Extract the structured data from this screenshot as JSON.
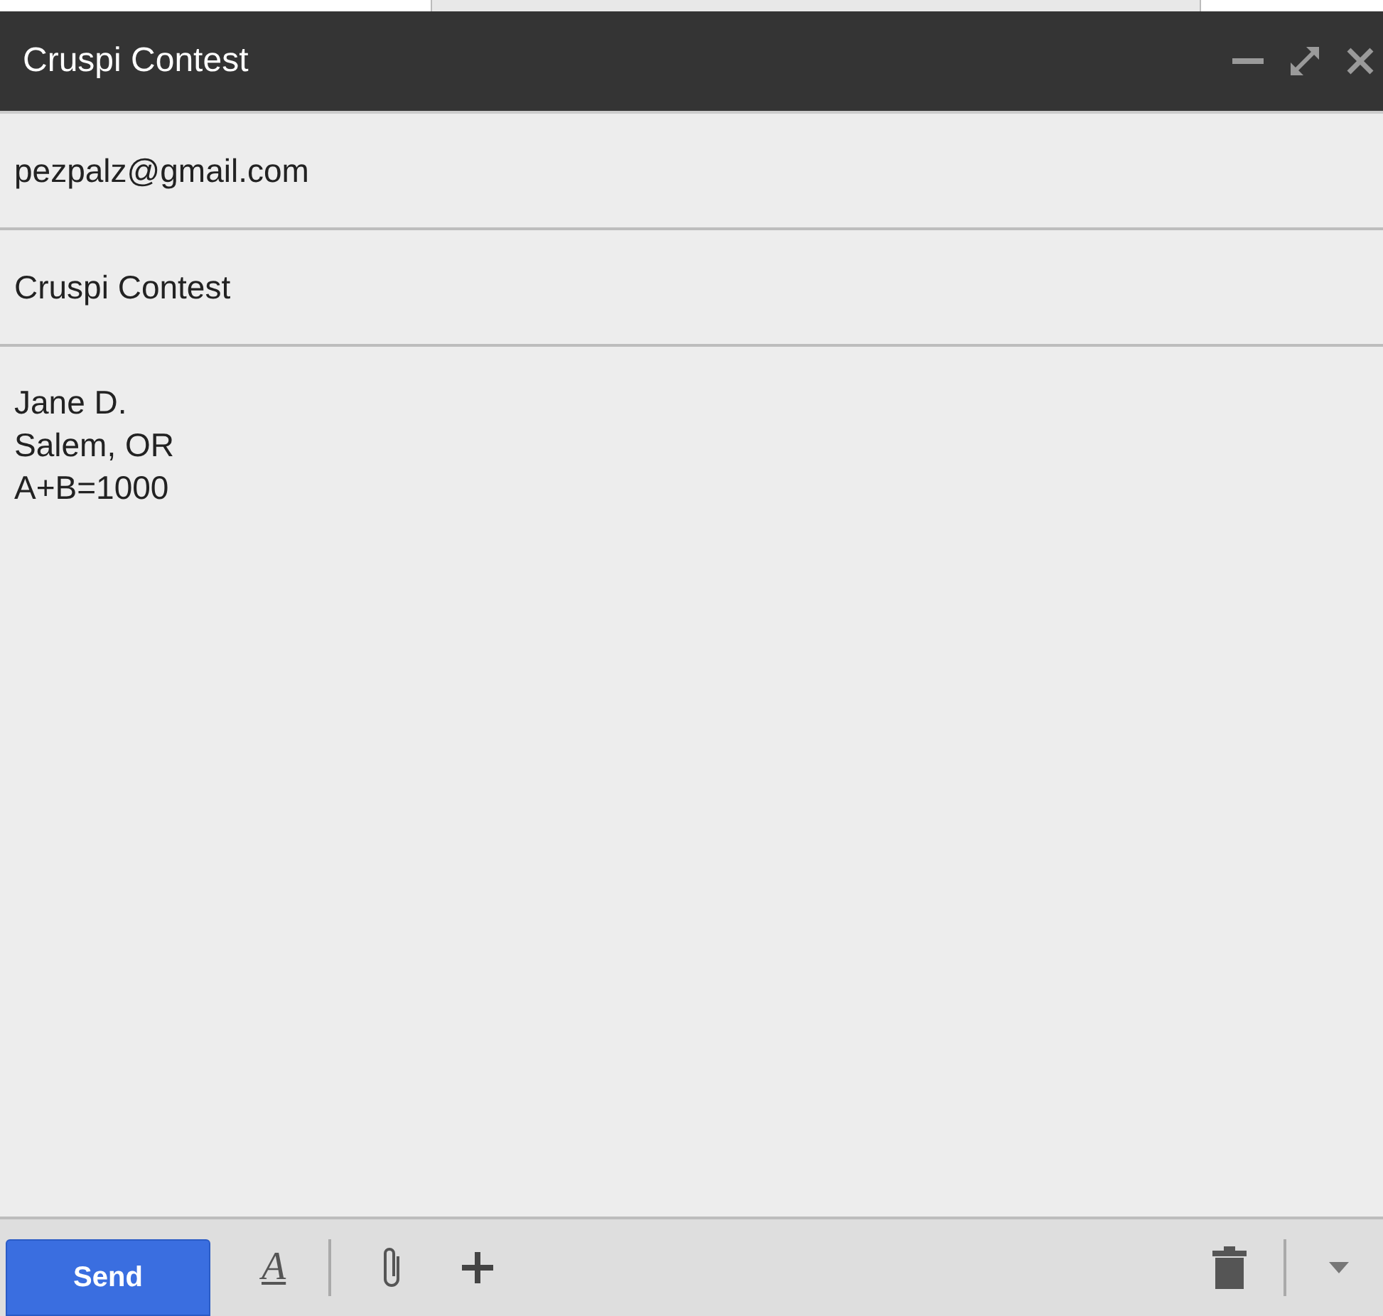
{
  "window": {
    "title": "Cruspi Contest"
  },
  "to": {
    "value": "pezpalz@gmail.com"
  },
  "subject": {
    "value": "Cruspi Contest"
  },
  "body": {
    "lines": [
      "Jane D.",
      "Salem, OR",
      "A+B=1000"
    ]
  },
  "toolbar": {
    "send": "Send",
    "format": "A"
  }
}
